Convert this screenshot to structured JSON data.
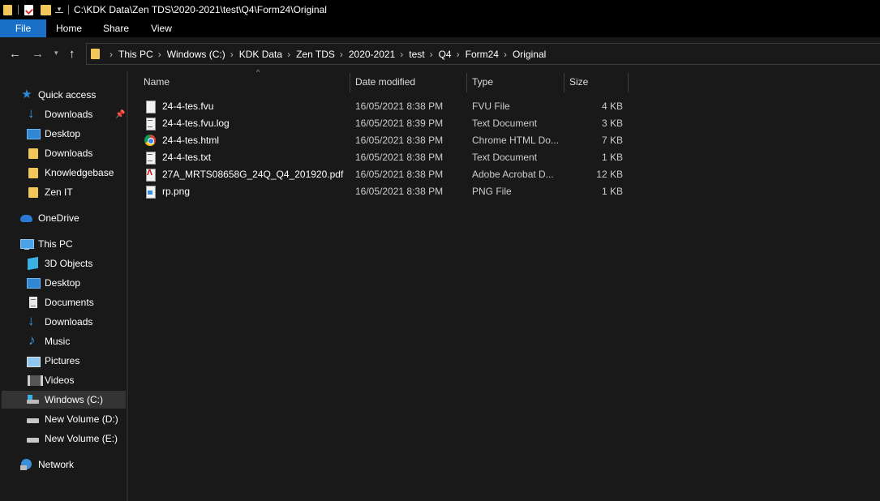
{
  "window": {
    "title": "C:\\KDK Data\\Zen TDS\\2020-2021\\test\\Q4\\Form24\\Original"
  },
  "ribbon": {
    "tabs": [
      "File",
      "Home",
      "Share",
      "View"
    ]
  },
  "nav": {
    "back_icon": "back-arrow-icon",
    "forward_icon": "forward-arrow-icon",
    "up_icon": "up-arrow-icon"
  },
  "breadcrumb": [
    "This PC",
    "Windows (C:)",
    "KDK Data",
    "Zen TDS",
    "2020-2021",
    "test",
    "Q4",
    "Form24",
    "Original"
  ],
  "sidebar": {
    "quick_access": "Quick access",
    "quick_items": [
      "Downloads",
      "Desktop",
      "Downloads",
      "Knowledgebase",
      "Zen IT"
    ],
    "onedrive": "OneDrive",
    "this_pc": "This PC",
    "pc_items": [
      "3D Objects",
      "Desktop",
      "Documents",
      "Downloads",
      "Music",
      "Pictures",
      "Videos",
      "Windows (C:)",
      "New Volume (D:)",
      "New Volume (E:)"
    ],
    "network": "Network",
    "selected": "Windows (C:)"
  },
  "columns": {
    "name": "Name",
    "date": "Date modified",
    "type": "Type",
    "size": "Size"
  },
  "files": [
    {
      "name": "24-4-tes.fvu",
      "date": "16/05/2021 8:38 PM",
      "type": "FVU File",
      "size": "4 KB",
      "icon": "fvu-file-icon"
    },
    {
      "name": "24-4-tes.fvu.log",
      "date": "16/05/2021 8:39 PM",
      "type": "Text Document",
      "size": "3 KB",
      "icon": "text-file-icon"
    },
    {
      "name": "24-4-tes.html",
      "date": "16/05/2021 8:38 PM",
      "type": "Chrome HTML Do...",
      "size": "7 KB",
      "icon": "chrome-icon"
    },
    {
      "name": "24-4-tes.txt",
      "date": "16/05/2021 8:38 PM",
      "type": "Text Document",
      "size": "1 KB",
      "icon": "text-file-icon"
    },
    {
      "name": "27A_MRTS08658G_24Q_Q4_201920.pdf",
      "date": "16/05/2021 8:38 PM",
      "type": "Adobe Acrobat D...",
      "size": "12 KB",
      "icon": "pdf-icon"
    },
    {
      "name": "rp.png",
      "date": "16/05/2021 8:38 PM",
      "type": "PNG File",
      "size": "1 KB",
      "icon": "png-file-icon"
    }
  ],
  "colors": {
    "accent": "#1a6fc7",
    "background": "#191919",
    "folder": "#f1c75a"
  }
}
